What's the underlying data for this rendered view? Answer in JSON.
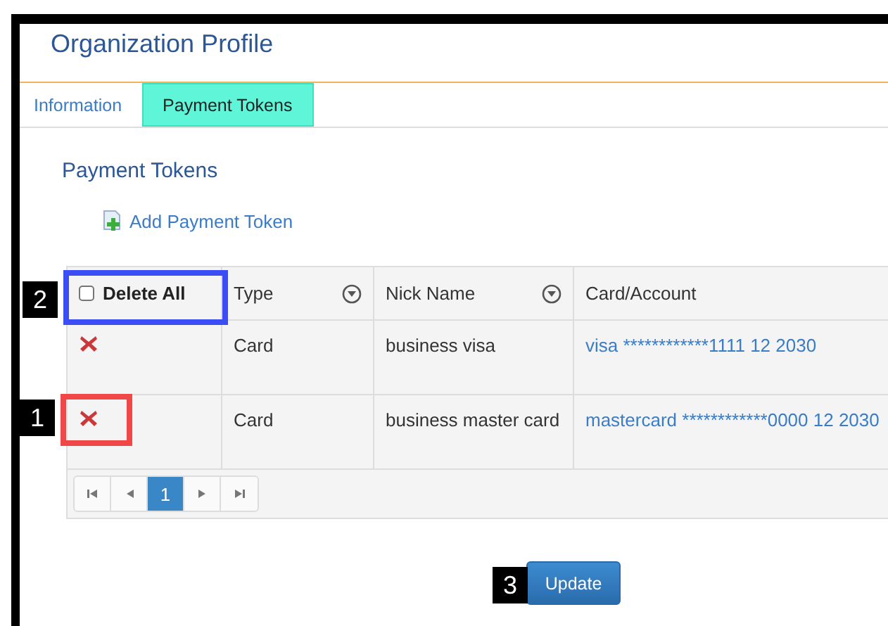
{
  "page": {
    "title": "Organization Profile"
  },
  "tabs": [
    {
      "label": "Information",
      "selected": false
    },
    {
      "label": "Payment Tokens",
      "selected": true
    }
  ],
  "section": {
    "heading": "Payment Tokens",
    "add_link": "Add Payment Token"
  },
  "table": {
    "delete_all": {
      "label": "Delete All",
      "checked": false,
      "callout": {
        "label": "2",
        "color": "#3b4ef5"
      }
    },
    "columns": [
      {
        "label": "Type",
        "filter": true
      },
      {
        "label": "Nick Name",
        "filter": true
      },
      {
        "label": "Card/Account",
        "filter": false
      }
    ],
    "rows": [
      {
        "type": "Card",
        "nick_name": "business visa",
        "account": "visa ************1111 12 2030"
      },
      {
        "type": "Card",
        "nick_name": "business master card",
        "account": "mastercard ************0000 12 2030",
        "callout": {
          "label": "1",
          "color": "#f04848"
        }
      }
    ],
    "pager": {
      "pages": [
        {
          "label": "1",
          "selected": true
        }
      ]
    }
  },
  "update_button": {
    "label": "Update",
    "callout": {
      "label": "3"
    }
  }
}
